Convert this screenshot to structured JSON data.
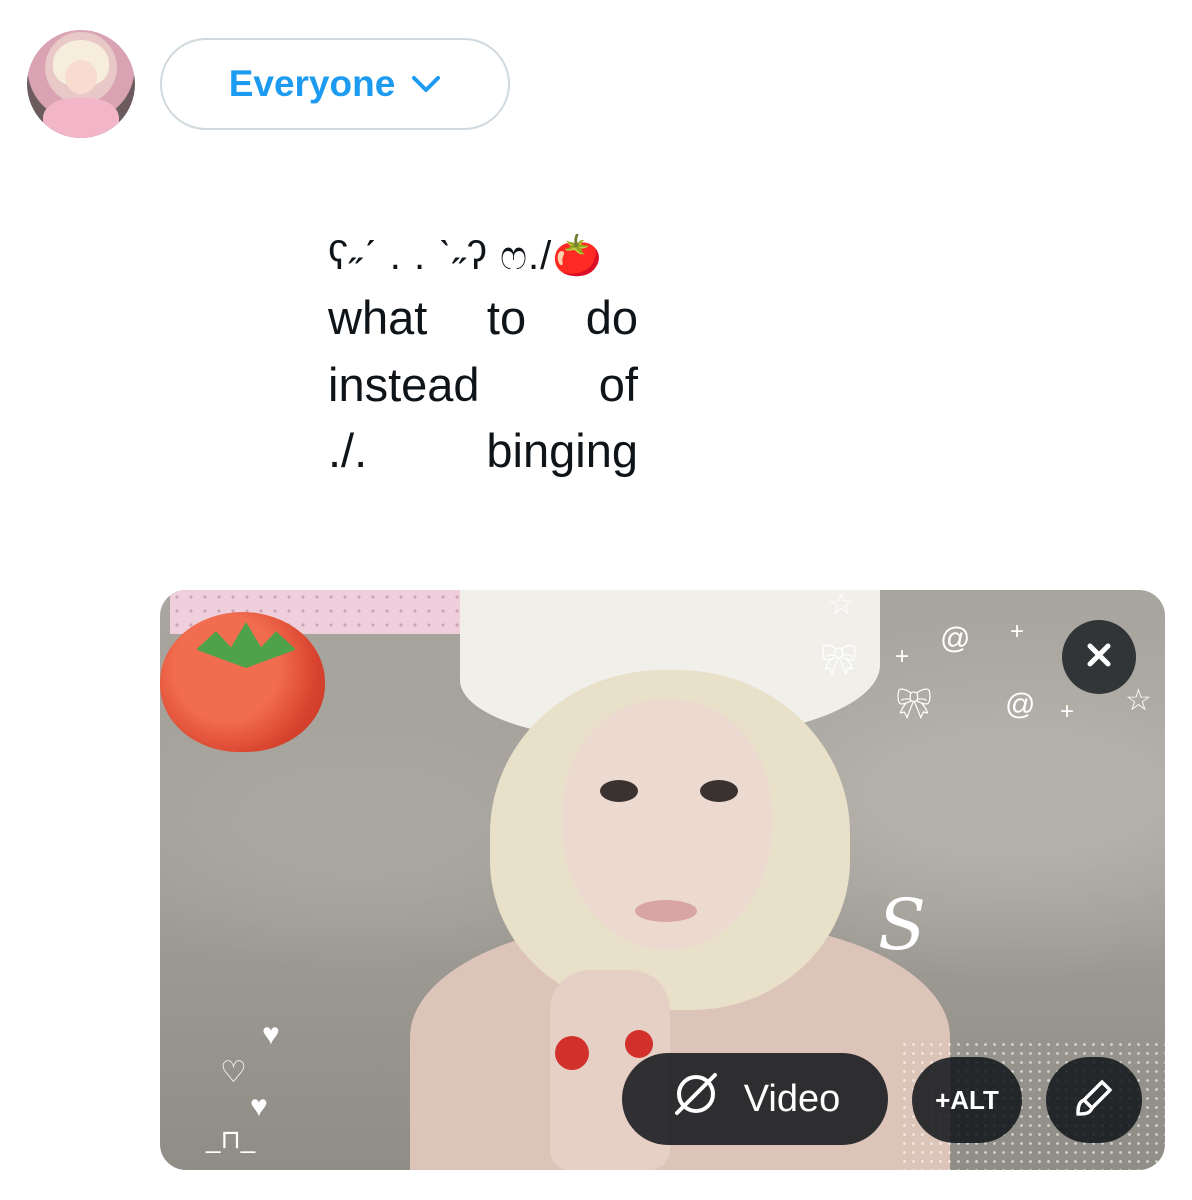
{
  "audience": {
    "label": "Everyone",
    "chevron_icon": "chevron-down-icon"
  },
  "post": {
    "kaomoji": "ʕ˶ˊ . . ˋ˶ʔ ෆ./",
    "emoji": "🍅",
    "lines": [
      [
        "what",
        "to",
        "do"
      ],
      [
        "instead",
        "of"
      ],
      [
        "./.",
        "binging"
      ]
    ]
  },
  "media": {
    "video_label": "Video",
    "alt_label": "+ALT",
    "close_icon": "close-icon",
    "edit_icon": "paintbrush-icon",
    "video_icon": "video-slash-icon"
  },
  "colors": {
    "accent": "#1d9bf0",
    "text": "#0f1419",
    "border": "#cfd9de",
    "overlay": "#0f1419"
  }
}
